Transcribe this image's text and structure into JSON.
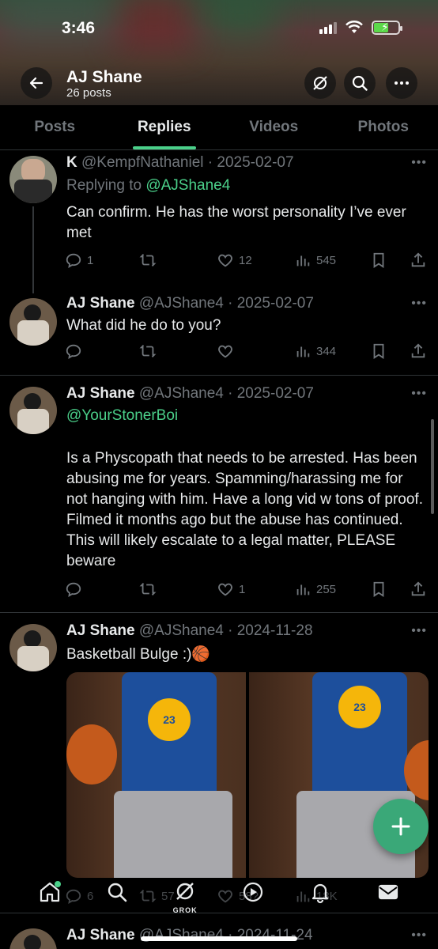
{
  "status_bar": {
    "time": "3:46"
  },
  "header": {
    "name": "AJ Shane",
    "posts_count": "26 posts"
  },
  "tabs": [
    {
      "label": "Posts",
      "active": false
    },
    {
      "label": "Replies",
      "active": true
    },
    {
      "label": "Videos",
      "active": false
    },
    {
      "label": "Photos",
      "active": false
    }
  ],
  "tweets": [
    {
      "name": "K",
      "handle": "@KempfNathaniel · 2025-02-07",
      "replying_prefix": "Replying to ",
      "replying_to": "@AJShane4",
      "text": "Can confirm. He has the worst personality I’ve ever met",
      "replies": "1",
      "reposts": "",
      "likes": "12",
      "views": "545"
    },
    {
      "name": "AJ Shane",
      "handle": "@AJShane4 · 2025-02-07",
      "text": "What did he do to you?",
      "replies": "",
      "reposts": "",
      "likes": "",
      "views": "344"
    },
    {
      "name": "AJ Shane",
      "handle": "@AJShane4 · 2025-02-07",
      "mention": "@YourStonerBoi",
      "text": "Is a Physcopath that needs to be arrested. Has been abusing me for years. Spamming/harassing me for not hanging with him. Have a long vid w tons of proof. Filmed it months ago but the abuse has continued. This will likely escalate to a legal matter, PLEASE beware",
      "replies": "",
      "reposts": "",
      "likes": "1",
      "views": "255"
    },
    {
      "name": "AJ Shane",
      "handle": "@AJShane4 · 2024-11-28",
      "text": "Basketball Bulge :)🏀",
      "media_jersey_text": "23",
      "replies": "6",
      "reposts": "57",
      "likes": "58?",
      "views": "18K"
    },
    {
      "name": "AJ Shane",
      "handle": "@AJShane4 · 2024-11-24"
    }
  ],
  "bottom_nav": {
    "grok_label": "GROK"
  },
  "colors": {
    "accent": "#4bd08a",
    "background": "#000000",
    "muted": "#71767b"
  }
}
